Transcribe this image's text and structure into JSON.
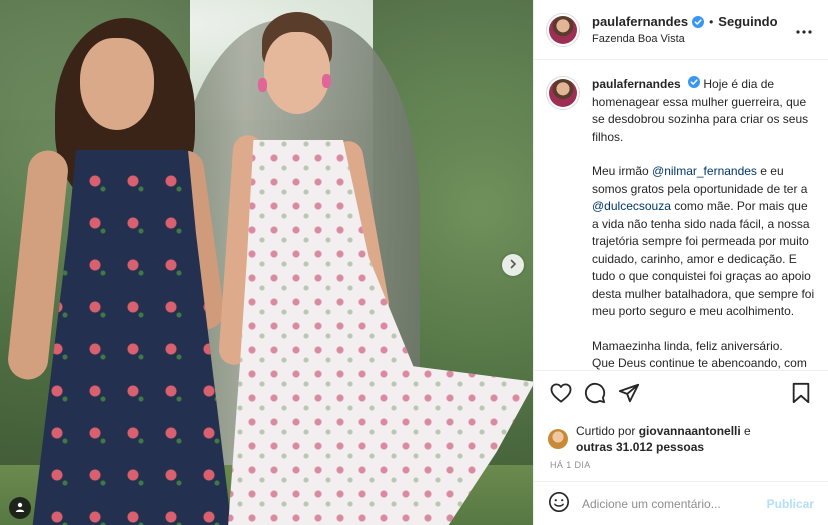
{
  "post": {
    "username": "paulafernandes",
    "follow_dot": "•",
    "follow_status": "Seguindo",
    "location": "Fazenda Boa Vista"
  },
  "caption": {
    "username": "paulafernandes",
    "p1": "Hoje é dia de homenagear essa mulher guerreira, que se desdobrou sozinha para criar os seus filhos.",
    "p2_before": "Meu irmão ",
    "p2_mention1": "@nilmar_fernandes",
    "p2_mid": " e eu somos gratos pela oportunidade de ter a ",
    "p2_mention2": "@dulcecsouza",
    "p2_after": " como mãe. Por mais que a vida não tenha sido nada fácil, a nossa trajetória sempre foi permeada por muito cuidado, carinho, amor e dedicação. E tudo o que conquistei foi graças ao apoio desta mulher batalhadora, que sempre foi meu porto seguro e meu acolhimento.",
    "p3_line1": "Mamaezinha linda, feliz aniversário.",
    "p3_line2": "Que Deus continue te abencoando, com"
  },
  "likes": {
    "prefix": "Curtido por ",
    "user": "giovannaantonelli",
    "mid": " e",
    "others": "outras 31.012 pessoas"
  },
  "time_ago": "HÁ 1 DIA",
  "comment": {
    "placeholder": "Adicione um comentário...",
    "publish_label": "Publicar"
  },
  "icons": {
    "like": "heart-icon",
    "comment": "comment-icon",
    "share": "paper-plane-icon",
    "save": "bookmark-icon",
    "emoji": "smiley-icon",
    "more": "ellipsis-icon",
    "verified": "verified-badge-icon",
    "next": "chevron-right-icon",
    "tags": "user-tag-icon"
  },
  "colors": {
    "verified": "#3897f0",
    "mention": "#00376b",
    "publish_disabled": "#b2dffc",
    "muted": "#8e8e8e"
  }
}
